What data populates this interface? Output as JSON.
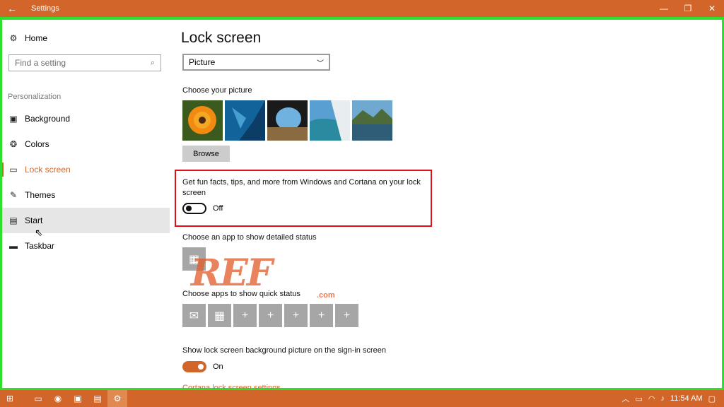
{
  "window": {
    "title": "Settings"
  },
  "sidebar": {
    "home_label": "Home",
    "search_placeholder": "Find a setting",
    "section_label": "Personalization",
    "items": [
      {
        "label": "Background",
        "icon": "image-icon"
      },
      {
        "label": "Colors",
        "icon": "palette-icon"
      },
      {
        "label": "Lock screen",
        "icon": "lock-screen-icon",
        "active": true
      },
      {
        "label": "Themes",
        "icon": "themes-icon"
      },
      {
        "label": "Start",
        "icon": "start-icon",
        "hovered": true
      },
      {
        "label": "Taskbar",
        "icon": "taskbar-icon"
      }
    ]
  },
  "main": {
    "title": "Lock screen",
    "background_dropdown": {
      "selected": "Picture"
    },
    "choose_picture_label": "Choose your picture",
    "browse_label": "Browse",
    "fun_facts": {
      "text": "Get fun facts, tips, and more from Windows and Cortana on your lock screen",
      "state_label": "Off",
      "value": false
    },
    "detailed_status_label": "Choose an app to show detailed status",
    "quick_status_label": "Choose apps to show quick status",
    "quick_status_tiles": [
      "mail-icon",
      "calendar-icon",
      "plus-icon",
      "plus-icon",
      "plus-icon",
      "plus-icon",
      "plus-icon"
    ],
    "signin_bg": {
      "label": "Show lock screen background picture on the sign-in screen",
      "state_label": "On",
      "value": true
    },
    "cortana_link": "Cortana lock screen settings"
  },
  "watermark": {
    "text": "REF",
    "sub": ".com"
  },
  "taskbar": {
    "clock": "11:54 AM"
  },
  "colors": {
    "accent": "#d2662a",
    "highlight_box": "#e0101a",
    "frame": "#2de02d"
  }
}
